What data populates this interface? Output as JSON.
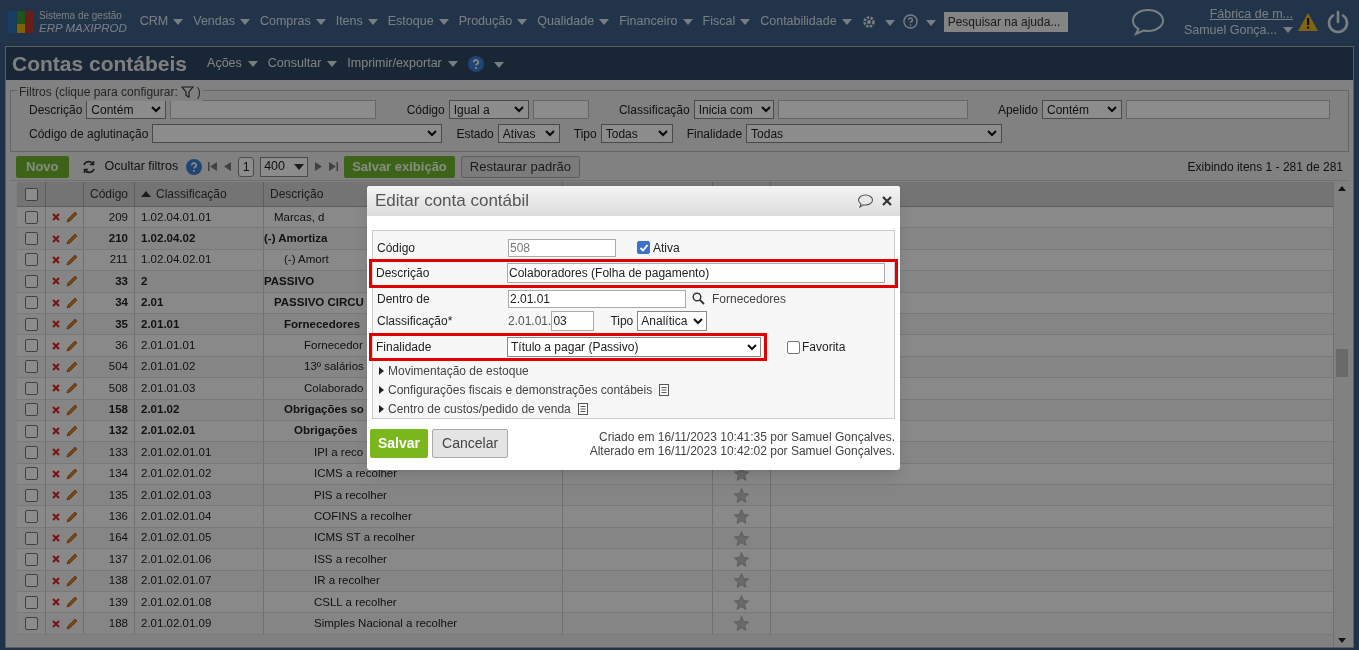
{
  "topbar": {
    "logo_line1": "Sistema de gestão",
    "logo_line2": "ERP MAXIPROD",
    "menus": [
      {
        "label": "CRM"
      },
      {
        "label": "Vendas"
      },
      {
        "label": "Compras"
      },
      {
        "label": "Itens"
      },
      {
        "label": "Estoque"
      },
      {
        "label": "Produção"
      },
      {
        "label": "Qualidade"
      },
      {
        "label": "Financeiro"
      },
      {
        "label": "Fiscal"
      },
      {
        "label": "Contabilidade"
      }
    ],
    "help_search": {
      "placeholder": "Pesquisar na ajuda..."
    },
    "company": "Fábrica de m...",
    "user": "Samuel Gonça..."
  },
  "page": {
    "title": "Contas contábeis",
    "menus": [
      "Ações",
      "Consultar",
      "Imprimir/exportar"
    ]
  },
  "filters": {
    "legend": "Filtros (clique para configurar:",
    "legend_end": ")",
    "row_1": [
      {
        "kind": "operator",
        "label": "Descrição",
        "operator": "Contém"
      },
      {
        "kind": "operator",
        "label": "Código",
        "operator": "Igual a"
      },
      {
        "kind": "operator",
        "label": "Classificação",
        "operator": "Inicia com"
      },
      {
        "kind": "operator",
        "label": "Apelido",
        "operator": "Contém"
      }
    ],
    "row_2": [
      {
        "kind": "select",
        "label": "Código de aglutinação"
      },
      {
        "kind": "select",
        "label": "Estado",
        "value": "Ativas"
      },
      {
        "kind": "select",
        "label": "Tipo",
        "value": "Todas"
      },
      {
        "kind": "select",
        "label": "Finalidade",
        "value": "Todas"
      }
    ]
  },
  "toolbar": {
    "new": "Novo",
    "hide_filters": "Ocultar filtros",
    "page": "1",
    "page_size": "400",
    "save_view": "Salvar exibição",
    "restore": "Restaurar padrão",
    "count": "Exibindo itens 1 - 281 de 281"
  },
  "table": {
    "select_all_checked": false,
    "columns": [
      {
        "label": "Código",
        "sorted": false
      },
      {
        "label": "Classificação",
        "sorted": true
      },
      {
        "label": "Descrição",
        "sorted": false
      }
    ],
    "rows": [
      {
        "code": "209",
        "class": "1.02.04.01.01",
        "desc": "Marcas, d",
        "kind": "account",
        "checked": false
      },
      {
        "code": "210",
        "class": "1.02.04.02",
        "desc": "(-) Amortiza",
        "kind": "group",
        "checked": false,
        "children": [
          {
            "code": "211",
            "class": "1.02.04.02.01",
            "desc": "(-) Amort",
            "kind": "account",
            "checked": false
          }
        ]
      },
      {
        "code": "33",
        "class": "2",
        "desc": "PASSIVO",
        "kind": "group",
        "checked": false,
        "children": [
          {
            "code": "34",
            "class": "2.01",
            "desc": "PASSIVO CIRCU",
            "kind": "group",
            "checked": false,
            "children": [
              {
                "code": "35",
                "class": "2.01.01",
                "desc": "Fornecedores",
                "kind": "group",
                "checked": false,
                "children": [
                  {
                    "code": "36",
                    "class": "2.01.01.01",
                    "desc": "Fornecedor",
                    "kind": "account",
                    "checked": false
                  },
                  {
                    "code": "504",
                    "class": "2.01.01.02",
                    "desc": "13º salários",
                    "kind": "account",
                    "checked": false
                  },
                  {
                    "code": "508",
                    "class": "2.01.01.03",
                    "desc": "Colaborado",
                    "kind": "account",
                    "checked": false
                  }
                ]
              },
              {
                "code": "158",
                "class": "2.01.02",
                "desc": "Obrigações so",
                "kind": "group",
                "checked": false,
                "children": [
                  {
                    "code": "132",
                    "class": "2.01.02.01",
                    "desc": "Obrigações",
                    "kind": "group",
                    "checked": false,
                    "children": [
                      {
                        "code": "133",
                        "class": "2.01.02.01.01",
                        "desc": "IPI a reco",
                        "kind": "account",
                        "checked": false
                      },
                      {
                        "code": "134",
                        "class": "2.01.02.01.02",
                        "desc": "ICMS a recolher",
                        "kind": "account",
                        "checked": false,
                        "favorite": false
                      },
                      {
                        "code": "135",
                        "class": "2.01.02.01.03",
                        "desc": "PIS a recolher",
                        "kind": "account",
                        "checked": false,
                        "favorite": false
                      },
                      {
                        "code": "136",
                        "class": "2.01.02.01.04",
                        "desc": "COFINS a recolher",
                        "kind": "account",
                        "checked": false,
                        "favorite": false
                      },
                      {
                        "code": "164",
                        "class": "2.01.02.01.05",
                        "desc": "ICMS ST a recolher",
                        "kind": "account",
                        "checked": false,
                        "favorite": false
                      },
                      {
                        "code": "137",
                        "class": "2.01.02.01.06",
                        "desc": "ISS a recolher",
                        "kind": "account",
                        "checked": false,
                        "favorite": false
                      },
                      {
                        "code": "138",
                        "class": "2.01.02.01.07",
                        "desc": "IR a recolher",
                        "kind": "account",
                        "checked": false,
                        "favorite": false
                      },
                      {
                        "code": "139",
                        "class": "2.01.02.01.08",
                        "desc": "CSLL a recolher",
                        "kind": "account",
                        "checked": false,
                        "favorite": false
                      },
                      {
                        "code": "188",
                        "class": "2.01.02.01.09",
                        "desc": "Simples Nacional a recolher",
                        "kind": "account",
                        "checked": false,
                        "favorite": false
                      }
                    ]
                  }
                ]
              }
            ]
          }
        ]
      }
    ]
  },
  "modal": {
    "title": "Editar conta contábil",
    "code": {
      "label": "Código",
      "value": "508",
      "disabled": true
    },
    "active": {
      "label": "Ativa",
      "checked": true
    },
    "description": {
      "label": "Descrição",
      "value": "Colaboradores (Folha de pagamento)",
      "highlighted": true
    },
    "parent": {
      "label": "Dentro de",
      "value": "2.01.01",
      "name": "Fornecedores"
    },
    "classification": {
      "label": "Classificação*",
      "prefix": "2.01.01.",
      "value": "03"
    },
    "type": {
      "label": "Tipo",
      "value": "Analítica"
    },
    "purpose": {
      "label": "Finalidade",
      "value": "Título a pagar (Passivo)",
      "highlighted": true
    },
    "favorite": {
      "label": "Favorita",
      "checked": false
    },
    "sections": [
      {
        "label": "Movimentação de estoque",
        "has_note": false
      },
      {
        "label": "Configurações fiscais e demonstrações contábeis",
        "has_note": true
      },
      {
        "label": "Centro de custos/pedido de venda",
        "has_note": true
      }
    ],
    "save": "Salvar",
    "cancel": "Cancelar",
    "created": "Criado em 16/11/2023 10:41:35 por Samuel Gonçalves.",
    "altered": "Alterado em 16/11/2023 10:42:02 por Samuel Gonçalves."
  }
}
